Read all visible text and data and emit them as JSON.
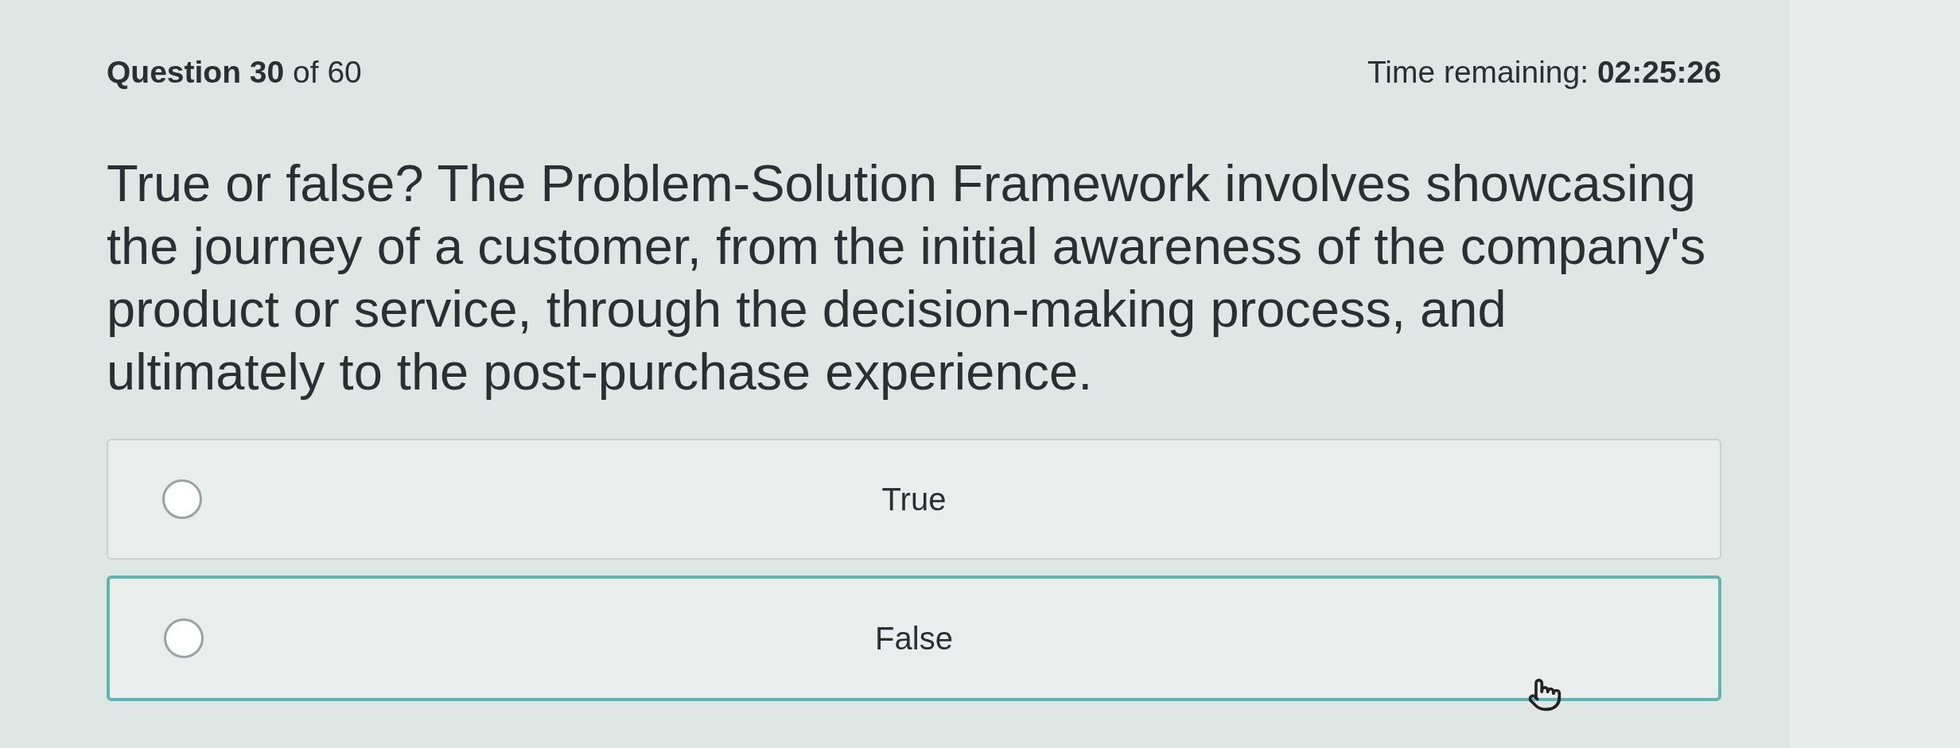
{
  "header": {
    "progress": "**Question 30** of 60",
    "timer": "Time remaining: **02:25:26**"
  },
  "question": "True or false? The Problem-Solution Framework involves showcasing the journey of a customer, from the initial awareness of the company's product or service, through the decision-making process, and ultimately to the post-purchase experience.",
  "options": [
    {
      "label": "True",
      "selected": false,
      "hovered": false
    },
    {
      "label": "False",
      "selected": false,
      "hovered": true
    }
  ]
}
